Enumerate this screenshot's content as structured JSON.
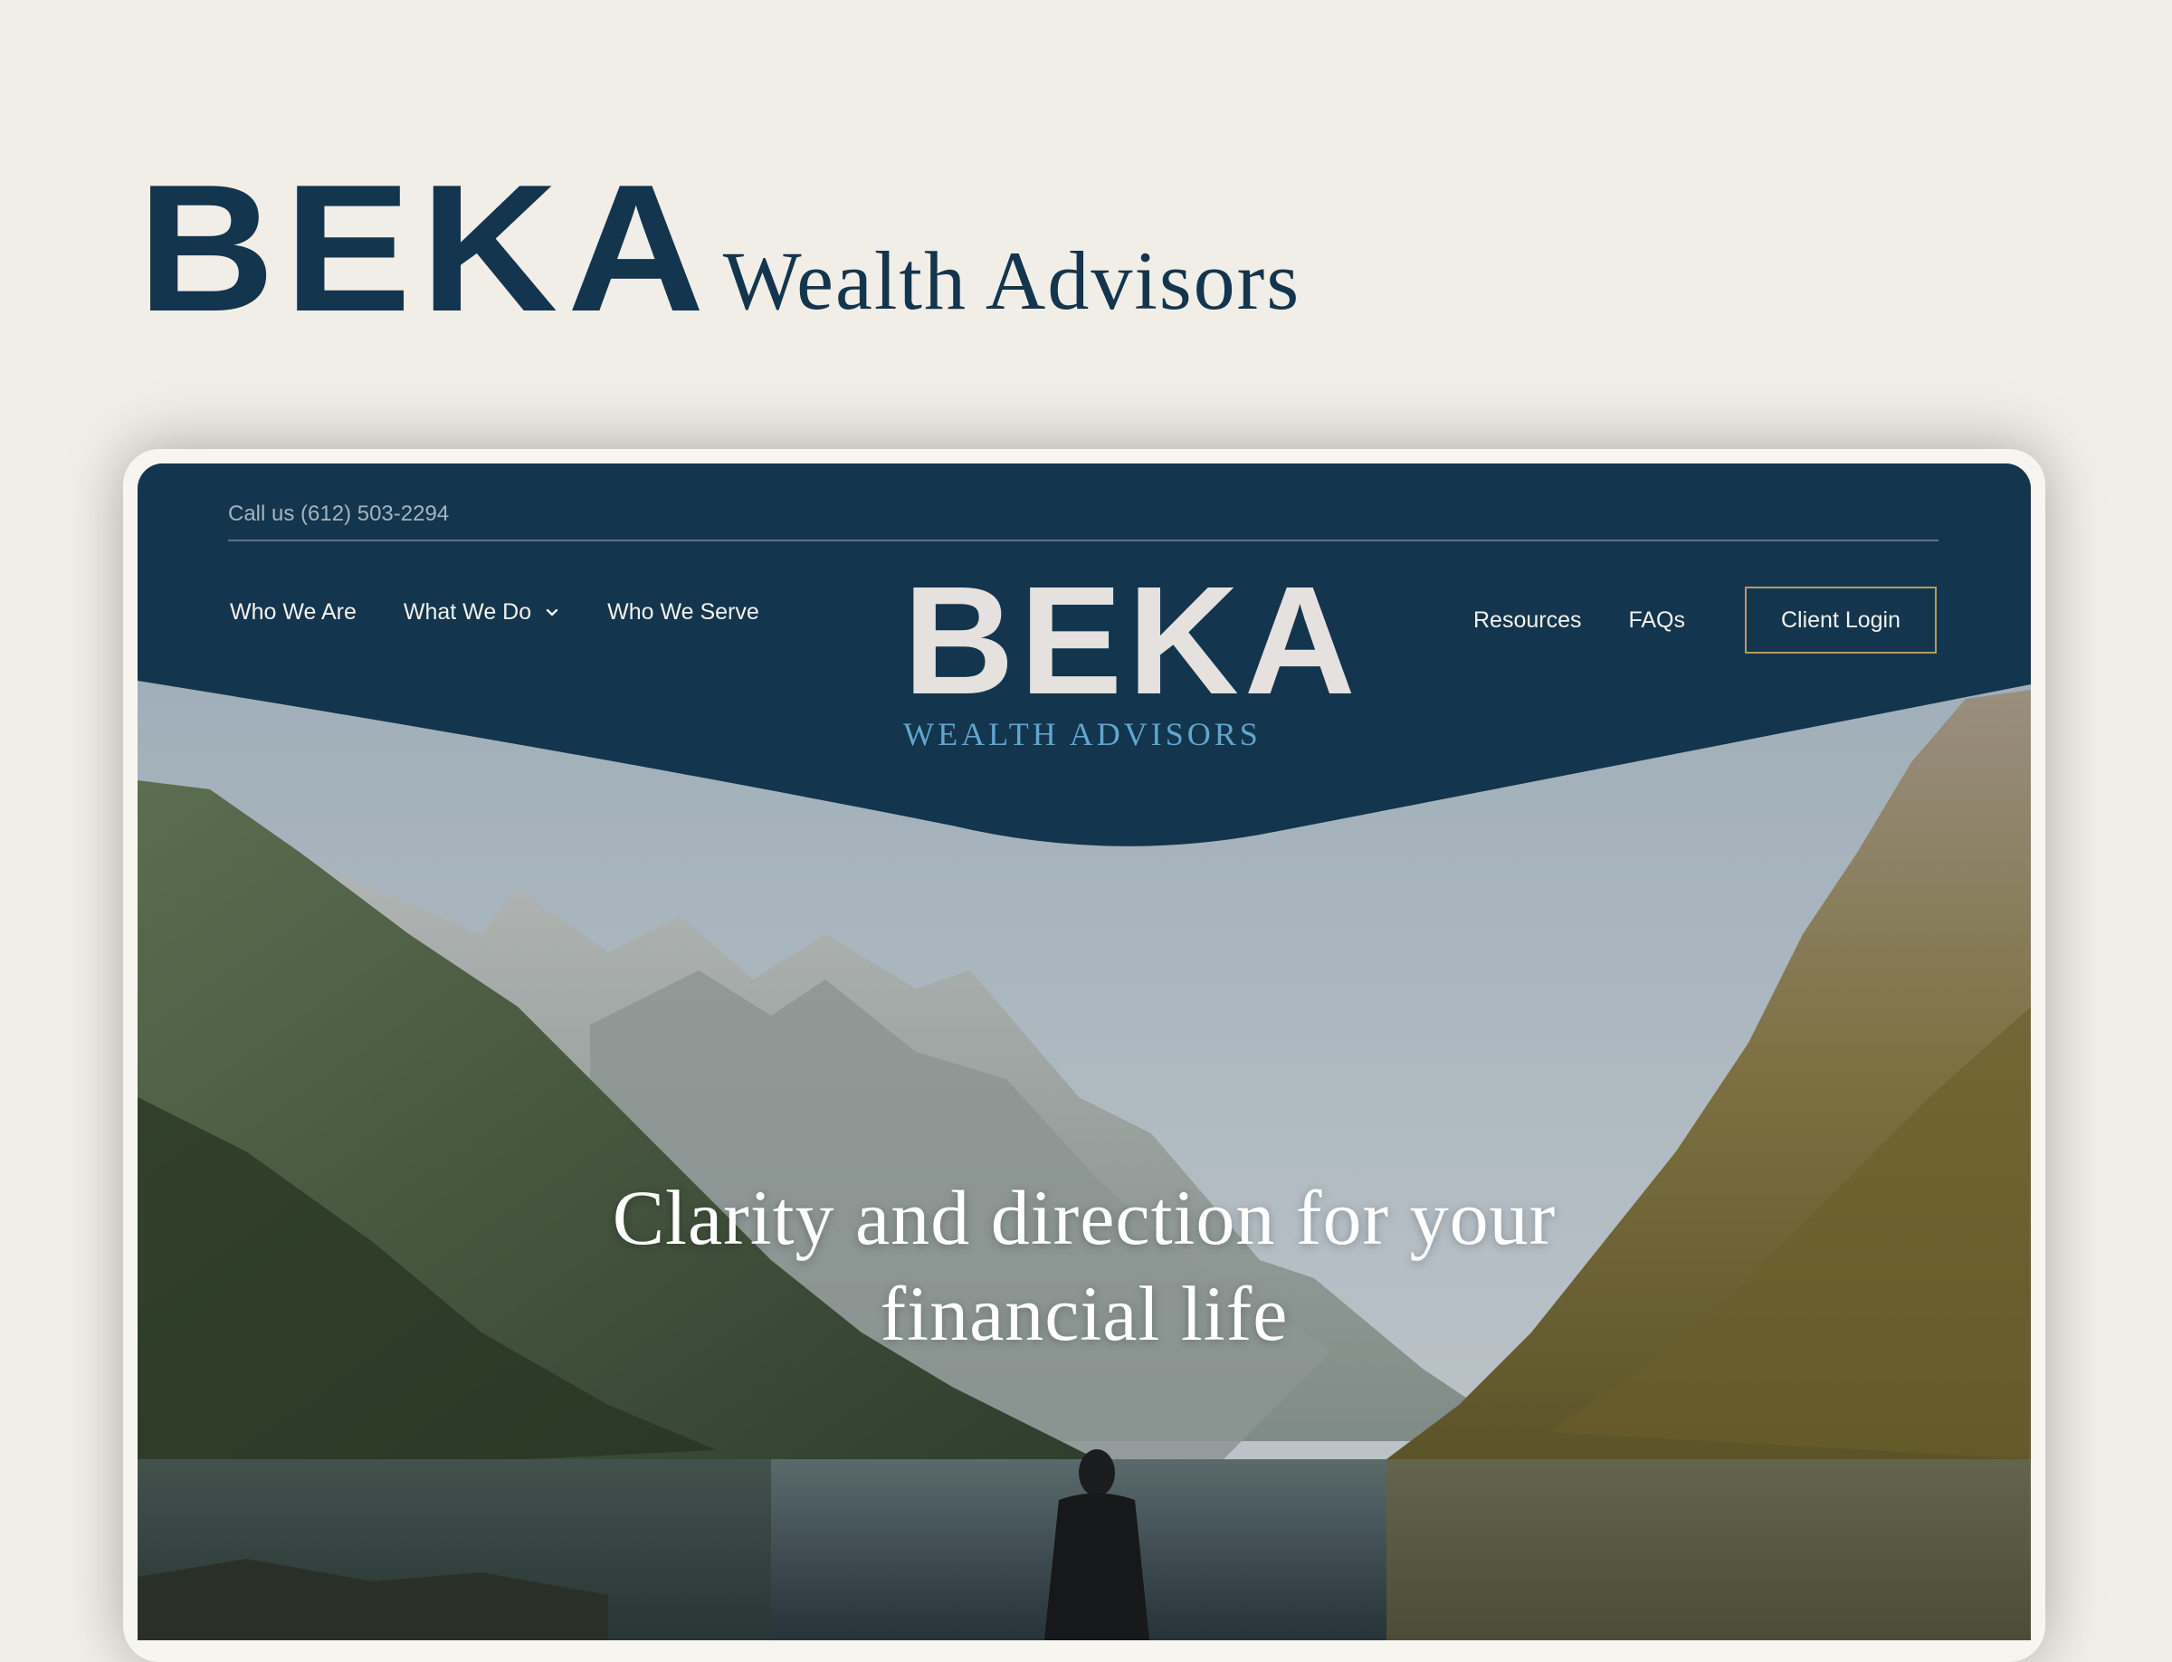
{
  "brand": {
    "mark": "BEKA",
    "wordmark": "Wealth Advisors"
  },
  "site": {
    "topbar": {
      "phone": "Call us (612) 503-2294"
    },
    "nav_left": [
      {
        "label": "Who We Are"
      },
      {
        "label": "What We Do",
        "has_dropdown": true,
        "icon": "chevron-down-icon"
      },
      {
        "label": "Who We Serve"
      }
    ],
    "nav_right": [
      {
        "label": "Resources"
      },
      {
        "label": "FAQs"
      }
    ],
    "login_label": "Client Login",
    "logo": {
      "mark": "BEKA",
      "sub": "WEALTH ADVISORS"
    },
    "hero": {
      "headline_line1": "Clarity and direction for your",
      "headline_line2": "financial life"
    }
  },
  "colors": {
    "navy": "#13354d",
    "cream": "#f1eee7",
    "accent_blue": "#62a5cf",
    "gold_border": "#b59a5e"
  }
}
